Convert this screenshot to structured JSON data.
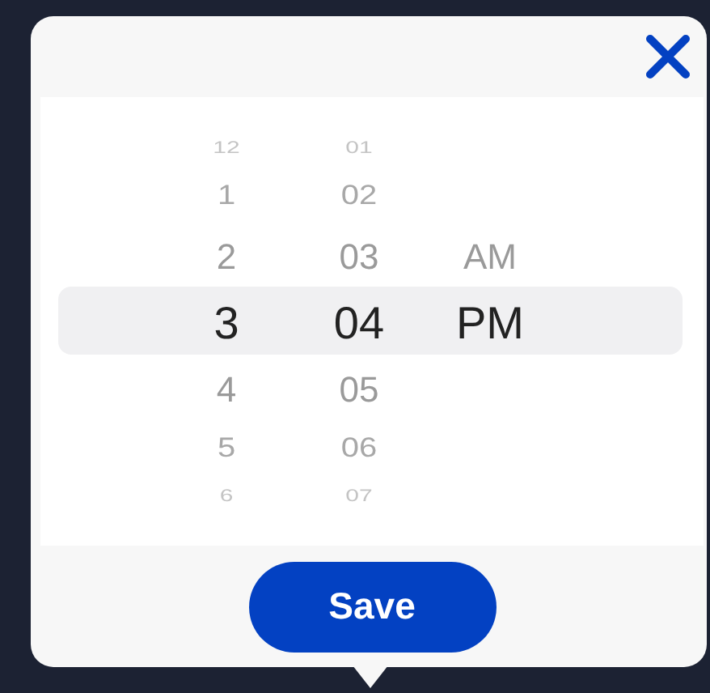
{
  "dialog": {
    "time_picker": {
      "columns": [
        {
          "kind": "hour",
          "items": [
            {
              "label": "12",
              "selected": false
            },
            {
              "label": "1",
              "selected": false
            },
            {
              "label": "2",
              "selected": false
            },
            {
              "label": "3",
              "selected": true
            },
            {
              "label": "4",
              "selected": false
            },
            {
              "label": "5",
              "selected": false
            },
            {
              "label": "6",
              "selected": false
            }
          ]
        },
        {
          "kind": "minute",
          "items": [
            {
              "label": "01",
              "selected": false
            },
            {
              "label": "02",
              "selected": false
            },
            {
              "label": "03",
              "selected": false
            },
            {
              "label": "04",
              "selected": true
            },
            {
              "label": "05",
              "selected": false
            },
            {
              "label": "06",
              "selected": false
            },
            {
              "label": "07",
              "selected": false
            }
          ]
        },
        {
          "kind": "period",
          "items": [
            {
              "label": "AM",
              "selected": false
            },
            {
              "label": "PM",
              "selected": true
            }
          ]
        }
      ]
    },
    "save_button": "Save"
  }
}
